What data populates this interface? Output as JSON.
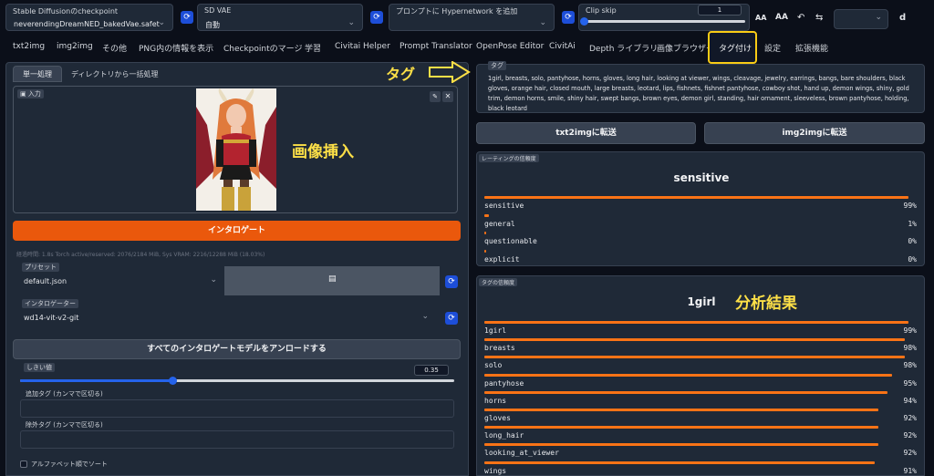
{
  "top": {
    "checkpoint": {
      "label": "Stable Diffusionのcheckpoint",
      "value": "neverendingDreamNED_bakedVae.safetensors [e"
    },
    "vae": {
      "label": "SD VAE",
      "value": "自動"
    },
    "hypernet": {
      "label": "プロンプトに Hypernetwork を追加",
      "value": ""
    },
    "clipskip": {
      "label": "Clip skip",
      "value": "1",
      "fraction": 0.0
    },
    "icons": {
      "a1": "AA",
      "a2": "AA",
      "d": "d"
    }
  },
  "tabs": [
    "txt2img",
    "img2img",
    "その他",
    "PNG内の情報を表示",
    "Checkpointのマージ",
    "学習",
    "Civitai Helper",
    "Prompt Translator",
    "OpenPose Editor",
    "CivitAi",
    "Depth ライブラリ",
    "画像ブラウザー",
    "タグ付け",
    "設定",
    "拡張機能"
  ],
  "subtabs": [
    "単一処理",
    "ディレクトリから一括処理"
  ],
  "input_label": "入力",
  "interrogate_button": "インタロゲート",
  "status_text": "経過時間: 1.8s  Torch active/reserved: 2076/2184 MiB, Sys VRAM: 2216/12288 MiB (18.03%)",
  "preset": {
    "label": "プリセット",
    "value": "default.json"
  },
  "interrogator": {
    "label": "インタロゲーター",
    "value": "wd14-vit-v2-git"
  },
  "unload_button": "すべてのインタロゲートモデルをアンロードする",
  "threshold": {
    "label": "しきい値",
    "value": "0.35",
    "fraction": 0.35
  },
  "additional_tags_label": "追加タグ (カンマで区切る)",
  "exclude_tags_label": "除外タグ (カンマで区切る)",
  "sort_label": "アルファベット順でソート",
  "tags_box": {
    "label": "タグ",
    "text": "1girl, breasts, solo, pantyhose, horns, gloves, long hair, looking at viewer, wings, cleavage, jewelry, earrings, bangs, bare shoulders, black gloves, orange hair, closed mouth, large breasts, leotard, lips, fishnets, fishnet pantyhose, cowboy shot, hand up, demon wings, shiny, gold trim, demon horns, smile, shiny hair, swept bangs, brown eyes, demon girl, standing, hair ornament, sleeveless, brown pantyhose, holding, black leotard"
  },
  "send_txt2img": "txt2imgに転送",
  "send_img2img": "img2imgに転送",
  "rating": {
    "label": "レーティングの信頼度",
    "title": "sensitive",
    "items": [
      {
        "name": "sensitive",
        "pct": "99%",
        "value": 0.99
      },
      {
        "name": "general",
        "pct": "1%",
        "value": 0.01
      },
      {
        "name": "questionable",
        "pct": "0%",
        "value": 0.0
      },
      {
        "name": "explicit",
        "pct": "0%",
        "value": 0.0
      }
    ]
  },
  "tagconf": {
    "label": "タグの信頼度",
    "title": "1girl",
    "items": [
      {
        "name": "1girl",
        "pct": "99%",
        "value": 0.99
      },
      {
        "name": "breasts",
        "pct": "98%",
        "value": 0.98
      },
      {
        "name": "solo",
        "pct": "98%",
        "value": 0.98
      },
      {
        "name": "pantyhose",
        "pct": "95%",
        "value": 0.95
      },
      {
        "name": "horns",
        "pct": "94%",
        "value": 0.94
      },
      {
        "name": "gloves",
        "pct": "92%",
        "value": 0.92
      },
      {
        "name": "long_hair",
        "pct": "92%",
        "value": 0.92
      },
      {
        "name": "looking_at_viewer",
        "pct": "92%",
        "value": 0.92
      },
      {
        "name": "wings",
        "pct": "91%",
        "value": 0.91
      }
    ]
  },
  "annotations": {
    "tag_arrow_label": "タグ",
    "image_insert": "画像挿入",
    "analysis_result": "分析結果"
  },
  "colors": {
    "accent": "#f97316",
    "highlight": "#fde047",
    "refresh": "#1d4ed8",
    "slider": "#2563eb"
  }
}
